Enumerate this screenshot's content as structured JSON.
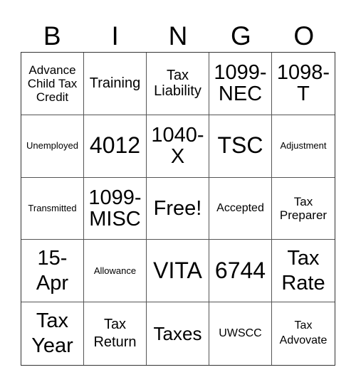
{
  "header": {
    "letters": [
      "B",
      "I",
      "N",
      "G",
      "O"
    ]
  },
  "cells": [
    "Advance Child Tax Credit",
    "Training",
    "Tax Liability",
    "1099-NEC",
    "1098-T",
    "Unemployed",
    "4012",
    "1040-X",
    "TSC",
    "Adjustment",
    "Transmitted",
    "1099-MISC",
    "Free!",
    "Accepted",
    "Tax Preparer",
    "15-Apr",
    "Allowance",
    "VITA",
    "6744",
    "Tax Rate",
    "Tax Year",
    "Tax Return",
    "Taxes",
    "UWSCC",
    "Tax Advovate"
  ],
  "free_space": {
    "label": "Free!",
    "index": 12
  }
}
